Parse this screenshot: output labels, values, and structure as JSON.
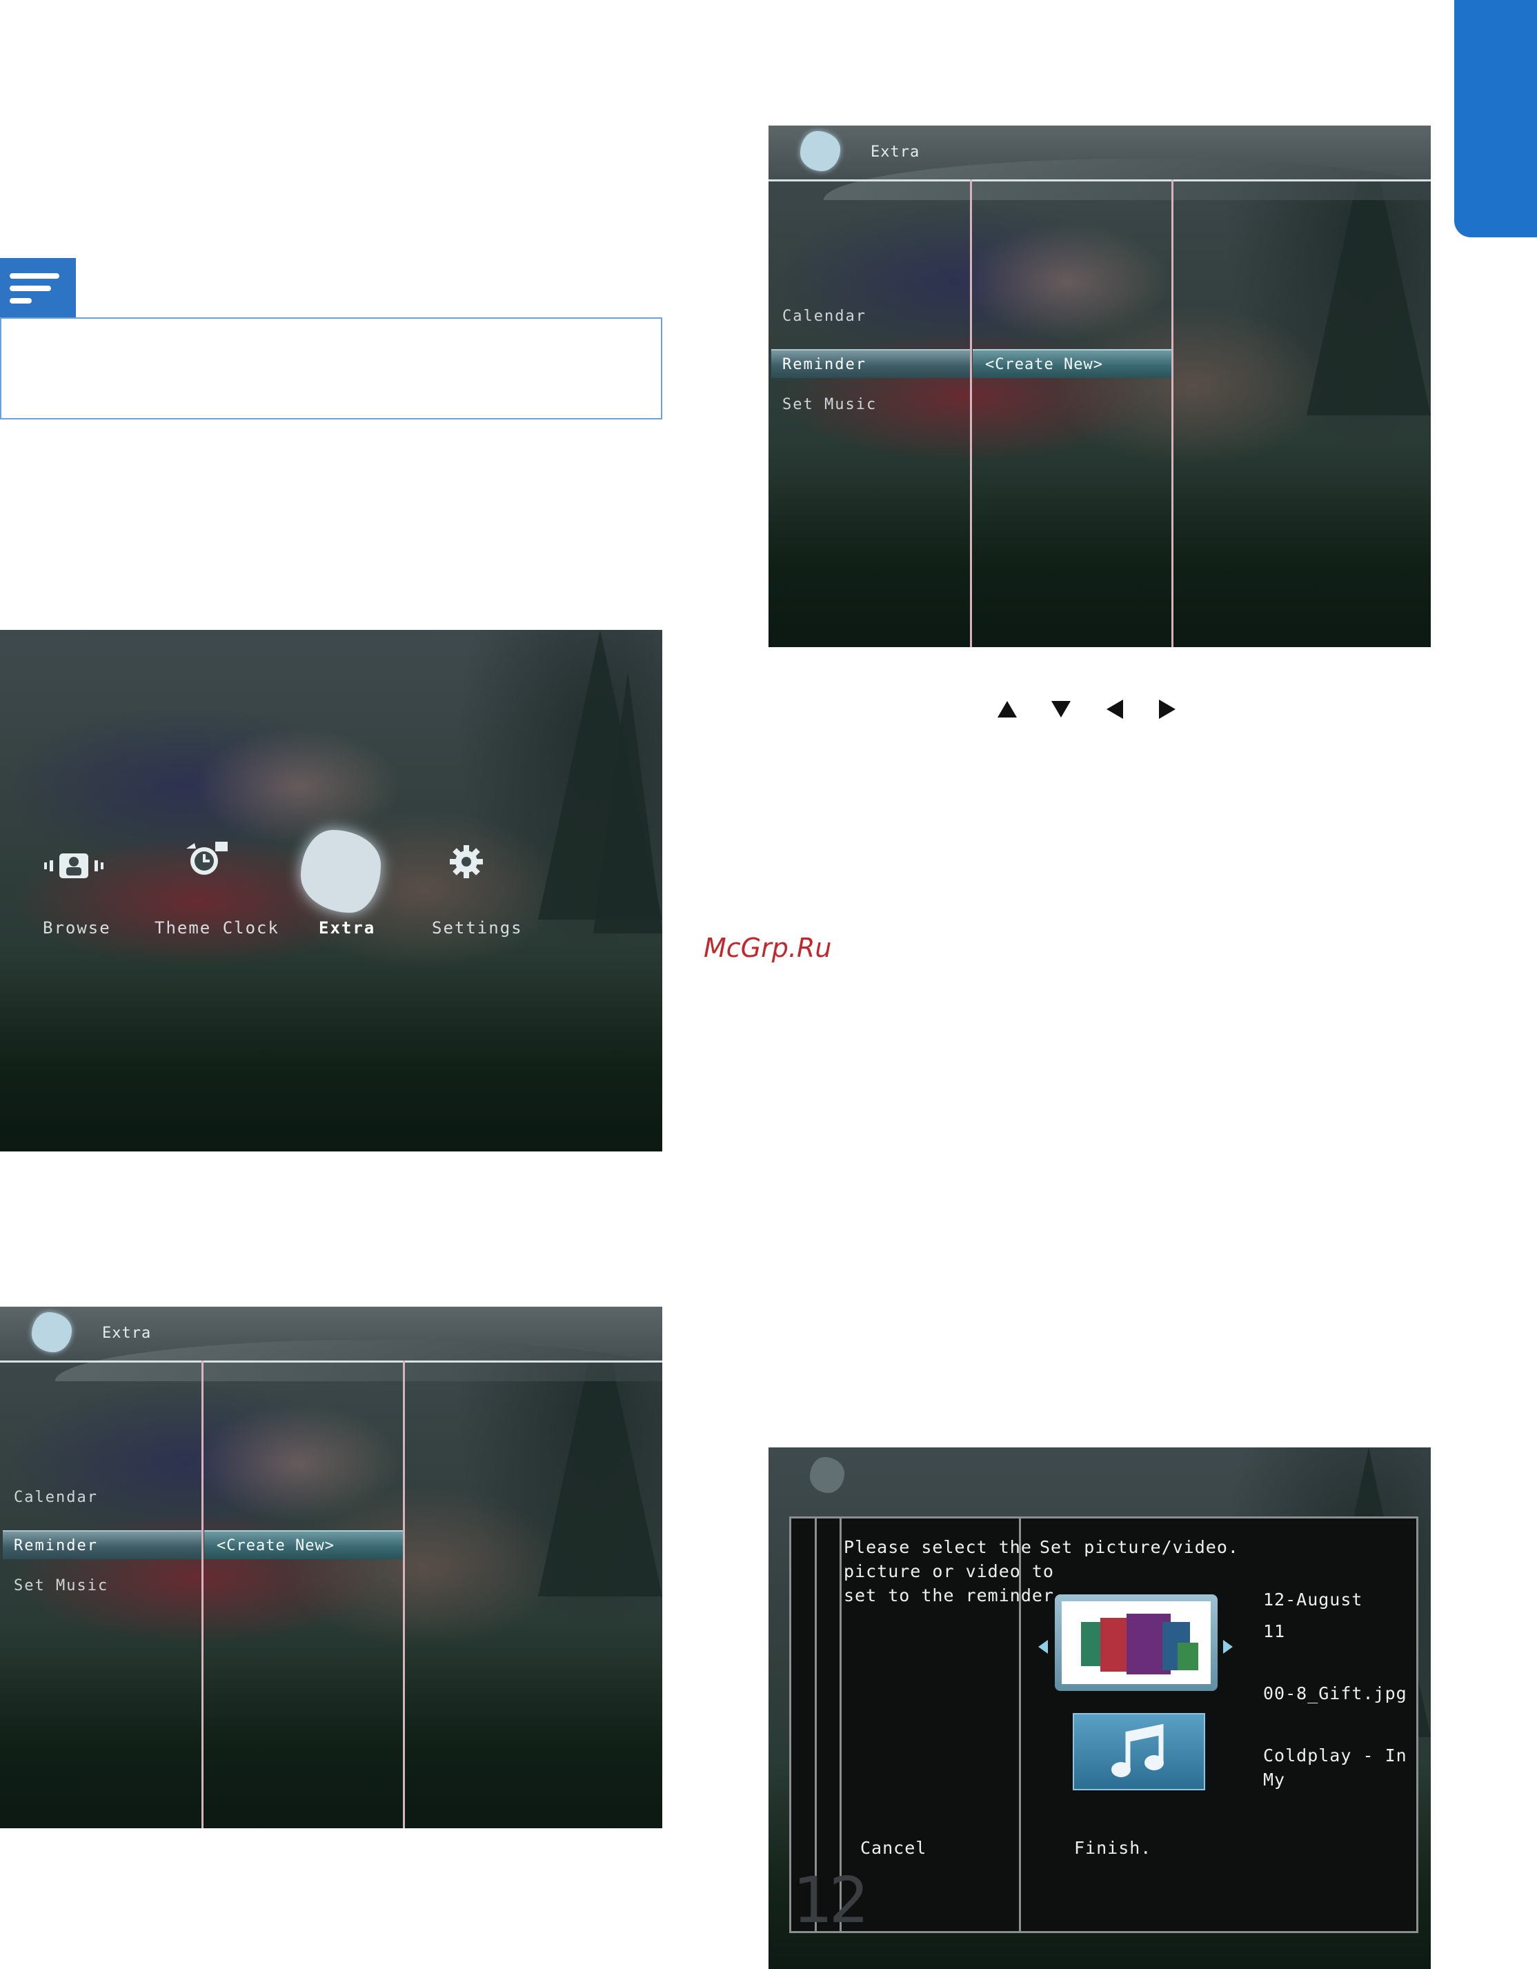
{
  "home_screen": {
    "items": [
      {
        "label": "Browse",
        "icon": "browse-icon"
      },
      {
        "label": "Theme Clock",
        "icon": "alarm-clock-icon"
      },
      {
        "label": "Extra",
        "icon": "extra-puzzle-icon",
        "active": true
      },
      {
        "label": "Settings",
        "icon": "gear-icon"
      }
    ]
  },
  "extra_screen": {
    "title": "Extra",
    "menu": [
      "Calendar",
      "Reminder",
      "Set Music"
    ],
    "selected": "Reminder",
    "submenu_selected": "<Create New>"
  },
  "reminder_dialog": {
    "instruction": [
      "Please select the",
      "picture or video to",
      "set to the reminder."
    ],
    "heading": "Set picture/video.",
    "date_line1": "12-August",
    "date_line2": "11",
    "filename": "00-8_Gift.jpg",
    "music": "Coldplay - In My",
    "cancel": "Cancel",
    "finish": "Finish.",
    "page_number": "12"
  },
  "watermark": "McGrp.Ru",
  "colors": {
    "tab_blue": "#1f72c9",
    "note_blue": "#2e74c5",
    "watermark_red": "#c0282d"
  }
}
